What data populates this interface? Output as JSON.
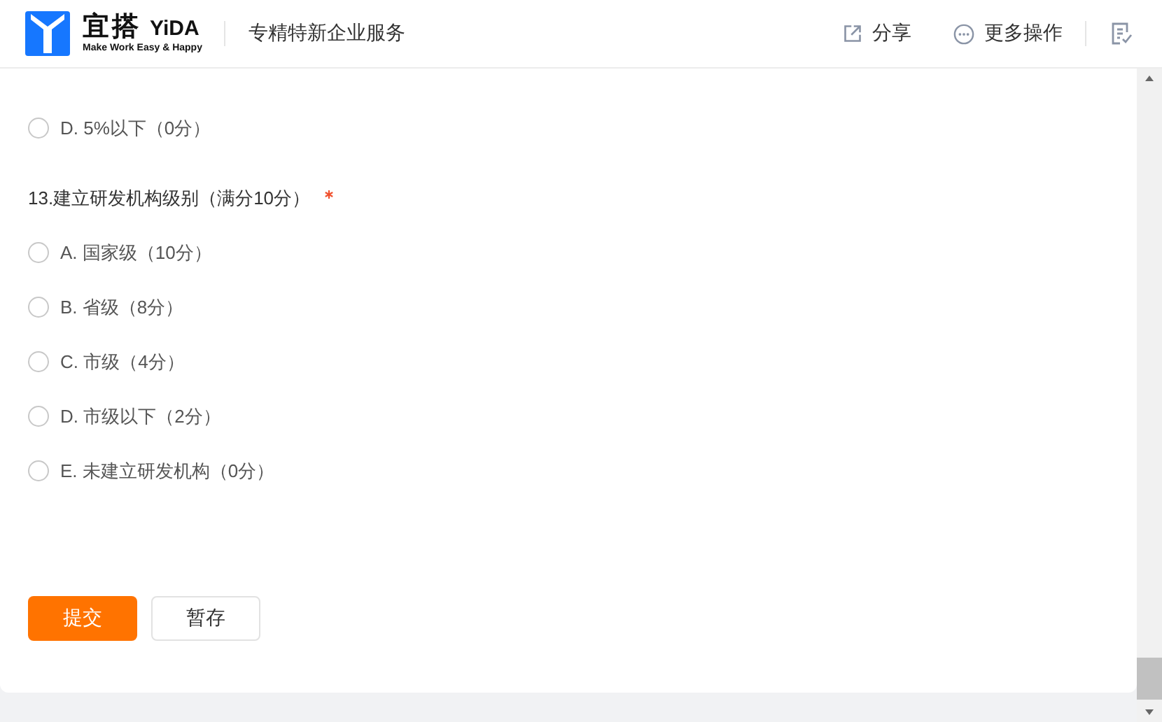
{
  "header": {
    "logo_name": "宜搭",
    "logo_brand": "YiDA",
    "logo_slogan": "Make Work Easy & Happy",
    "app_title": "专精特新企业服务",
    "actions": [
      {
        "label": "分享",
        "kind": "share"
      },
      {
        "label": "更多操作",
        "kind": "more"
      }
    ]
  },
  "questions": [
    {
      "options": [
        {
          "label": "D. 5%以下（0分）",
          "selected": false
        }
      ]
    },
    {
      "title": "13.建立研发机构级别（满分10分）",
      "required": true,
      "options": [
        {
          "label": "A. 国家级（10分）",
          "selected": false
        },
        {
          "label": "B. 省级（8分）",
          "selected": false
        },
        {
          "label": "C. 市级（4分）",
          "selected": false
        },
        {
          "label": "D. 市级以下（2分）",
          "selected": false
        },
        {
          "label": "E. 未建立研发机构（0分）",
          "selected": false
        }
      ]
    }
  ],
  "buttons": [
    {
      "label": "提交",
      "kind": "primary"
    },
    {
      "label": "暂存",
      "kind": "secondary"
    }
  ]
}
